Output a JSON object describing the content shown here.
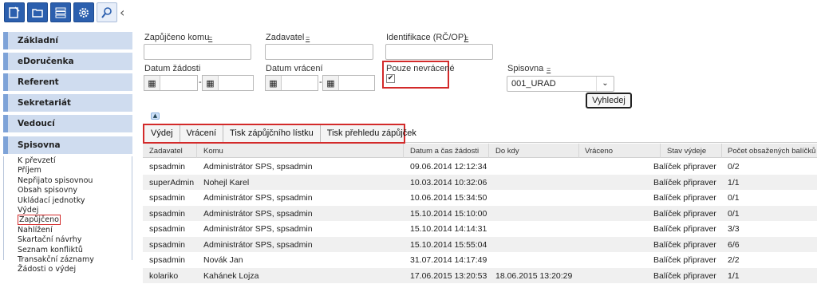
{
  "toolbar": {
    "buttons": [
      "new-document-icon",
      "folder-icon",
      "list-icon",
      "gear-icon",
      "search-icon"
    ],
    "collapse_icon": "chevron-left-icon"
  },
  "sidebar": {
    "sections": [
      "Základní",
      "eDoručenka",
      "Referent",
      "Sekretariát",
      "Vedoucí",
      "Spisovna"
    ],
    "items": [
      "K převzetí",
      "Příjem",
      "Nepřijato spisovnou",
      "Obsah spisovny",
      "Ukládací jednotky",
      "Výdej",
      "Zapůjčeno",
      "Nahlížení",
      "Skartační návrhy",
      "Seznam konfliktů",
      "Transakční záznamy",
      "Žádosti o výdej"
    ],
    "active_item": "Zapůjčeno"
  },
  "filters": {
    "borrowed_to_label": "Zapůjčeno komu",
    "requester_label": "Zadavatel",
    "identification_label": "Identifikace (RČ/OP)",
    "eq_symbol": "=",
    "request_date_label": "Datum žádosti",
    "return_date_label": "Datum vrácení",
    "date_dash": "-",
    "not_returned_label": "Pouze nevrácené",
    "not_returned_checked": "✔",
    "archive_label": "Spisovna",
    "archive_value": "001_URAD",
    "search_button": "Vyhledej"
  },
  "actions": [
    "Výdej",
    "Vrácení",
    "Tisk zápůjčního lístku",
    "Tisk přehledu zápůjček"
  ],
  "table": {
    "headers": [
      "Zadavatel",
      "Komu",
      "Datum a čas žádosti",
      "Do kdy",
      "Vráceno",
      "Stav výdeje",
      "Počet obsažených balíčků"
    ],
    "rows": [
      [
        "spsadmin",
        "Administrátor SPS, spsadmin",
        "09.06.2014 12:12:34",
        "",
        "",
        "Balíček připraver",
        "0/2"
      ],
      [
        "superAdmin",
        "Nohejl Karel",
        "10.03.2014 10:32:06",
        "",
        "",
        "Balíček připraver",
        "1/1"
      ],
      [
        "spsadmin",
        "Administrátor SPS, spsadmin",
        "10.06.2014 15:34:50",
        "",
        "",
        "Balíček připraver",
        "0/1"
      ],
      [
        "spsadmin",
        "Administrátor SPS, spsadmin",
        "15.10.2014 15:10:00",
        "",
        "",
        "Balíček připraver",
        "0/1"
      ],
      [
        "spsadmin",
        "Administrátor SPS, spsadmin",
        "15.10.2014 14:14:31",
        "",
        "",
        "Balíček připraver",
        "3/3"
      ],
      [
        "spsadmin",
        "Administrátor SPS, spsadmin",
        "15.10.2014 15:55:04",
        "",
        "",
        "Balíček připraver",
        "6/6"
      ],
      [
        "spsadmin",
        "Novák Jan",
        "31.07.2014 14:17:49",
        "",
        "",
        "Balíček připraver",
        "2/2"
      ],
      [
        "kolariko",
        "Kahánek Lojza",
        "17.06.2015 13:20:53",
        "18.06.2015 13:20:29",
        "",
        "Balíček připraver",
        "1/1"
      ]
    ]
  }
}
